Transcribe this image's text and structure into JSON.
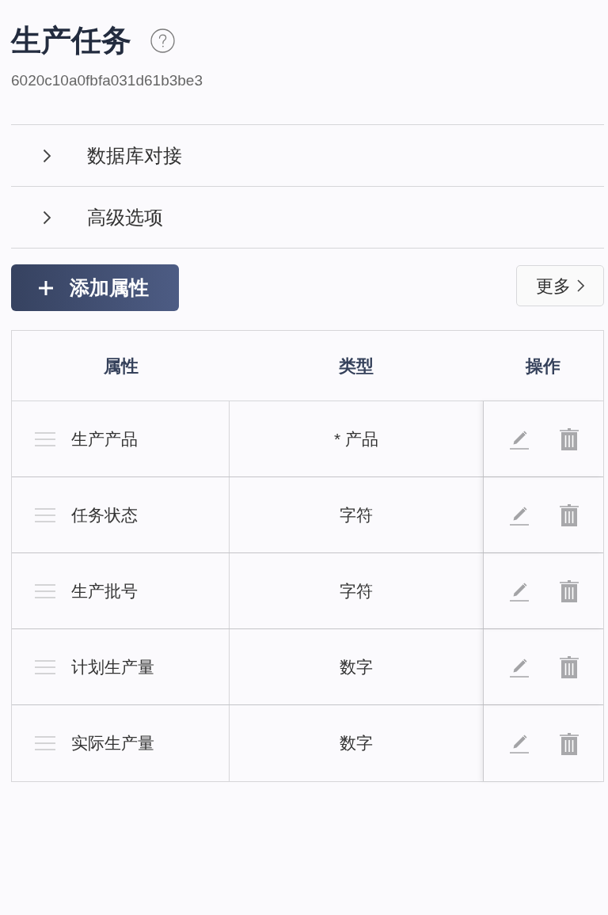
{
  "page": {
    "title": "生产任务",
    "record_id": "6020c10a0fbfa031d61b3be3"
  },
  "sections": [
    {
      "label": "数据库对接",
      "expanded": false
    },
    {
      "label": "高级选项",
      "expanded": false
    }
  ],
  "toolbar": {
    "add_button": "添加属性",
    "more_button": "更多"
  },
  "table": {
    "columns": [
      "属性",
      "类型",
      "操作"
    ],
    "rows": [
      {
        "name": "生产产品",
        "type": "* 产品"
      },
      {
        "name": "任务状态",
        "type": "字符"
      },
      {
        "name": "生产批号",
        "type": "字符"
      },
      {
        "name": "计划生产量",
        "type": "数字"
      },
      {
        "name": "实际生产量",
        "type": "数字"
      }
    ]
  }
}
